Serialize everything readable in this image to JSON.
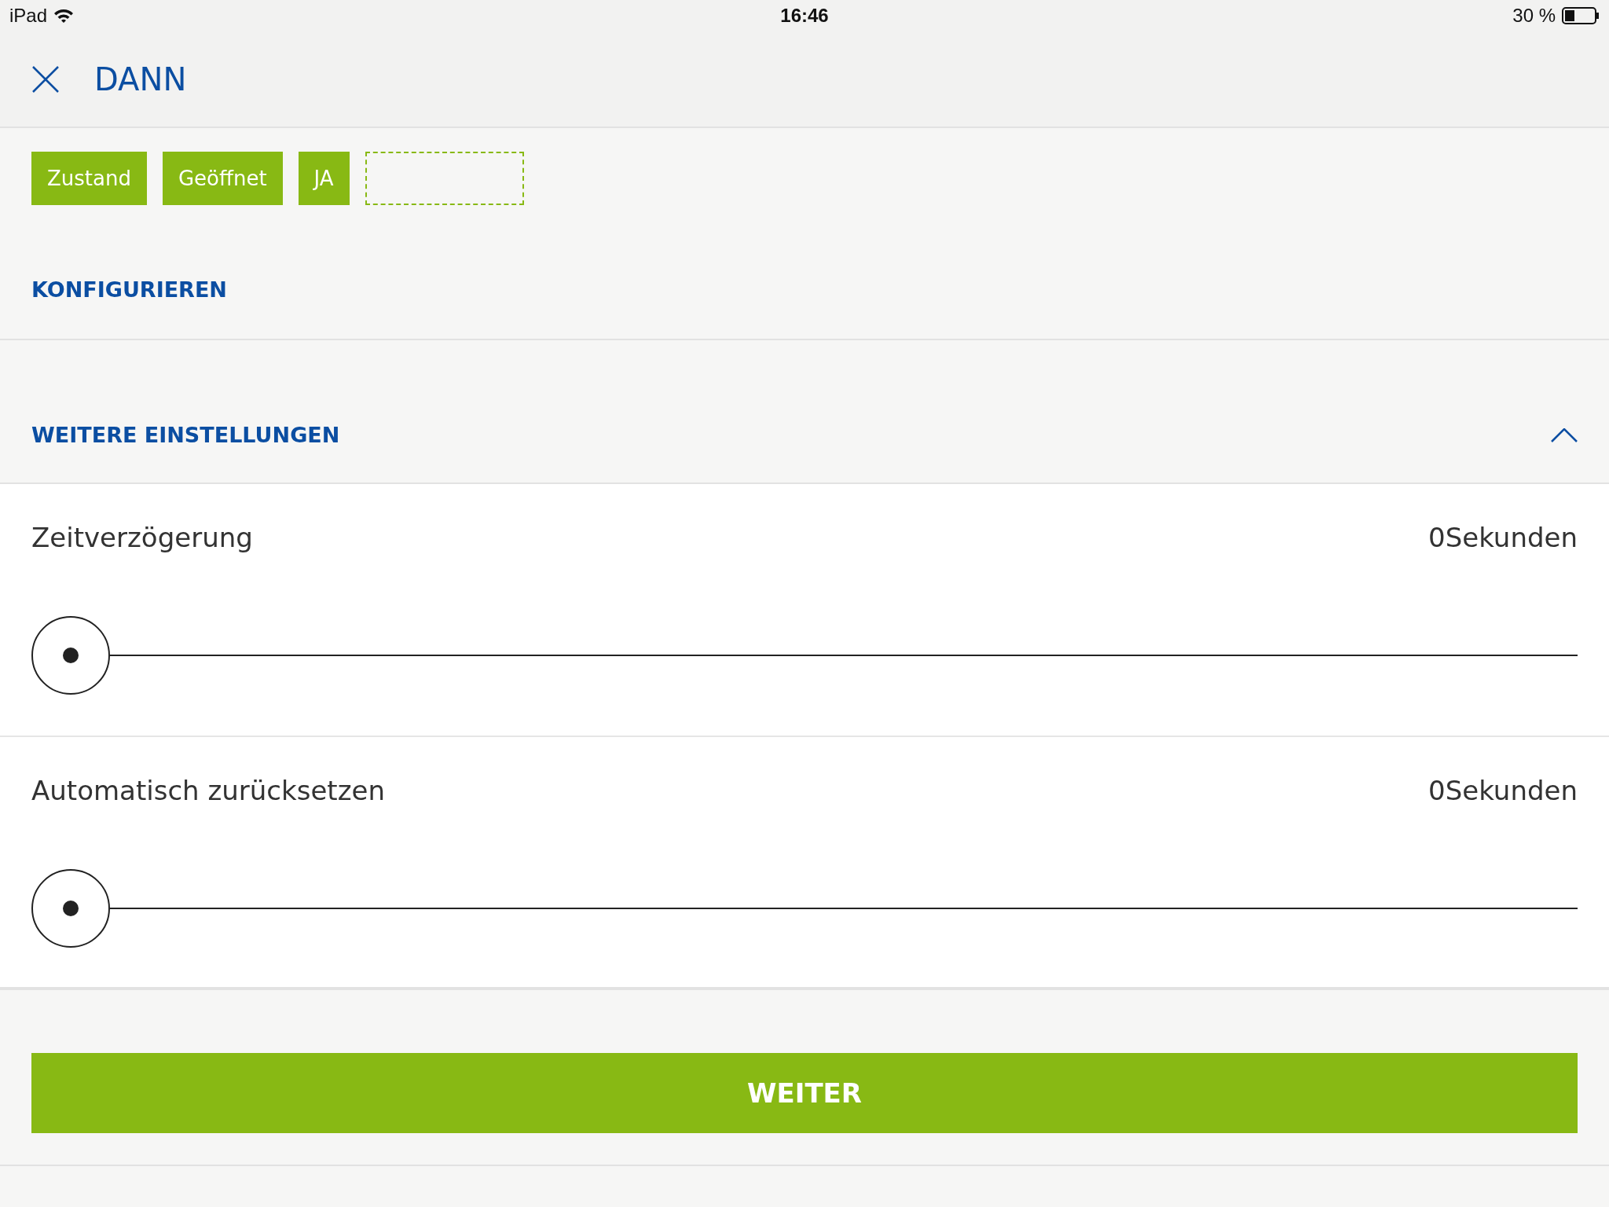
{
  "status_bar": {
    "device": "iPad",
    "time": "16:46",
    "battery": "30 %"
  },
  "header": {
    "title": "DANN"
  },
  "chips": [
    {
      "label": "Zustand",
      "kind": "filled"
    },
    {
      "label": "Geöffnet",
      "kind": "filled"
    },
    {
      "label": "JA",
      "kind": "filled"
    },
    {
      "kind": "empty"
    }
  ],
  "configure_link": "KONFIGURIEREN",
  "more_settings": {
    "title": "WEITERE EINSTELLUNGEN",
    "expanded": true
  },
  "settings": [
    {
      "label": "Zeitverzögerung",
      "reading": "0Sekunden"
    },
    {
      "label": "Automatisch zurücksetzen",
      "reading": "0Sekunden"
    }
  ],
  "primary_button": "WEITER"
}
